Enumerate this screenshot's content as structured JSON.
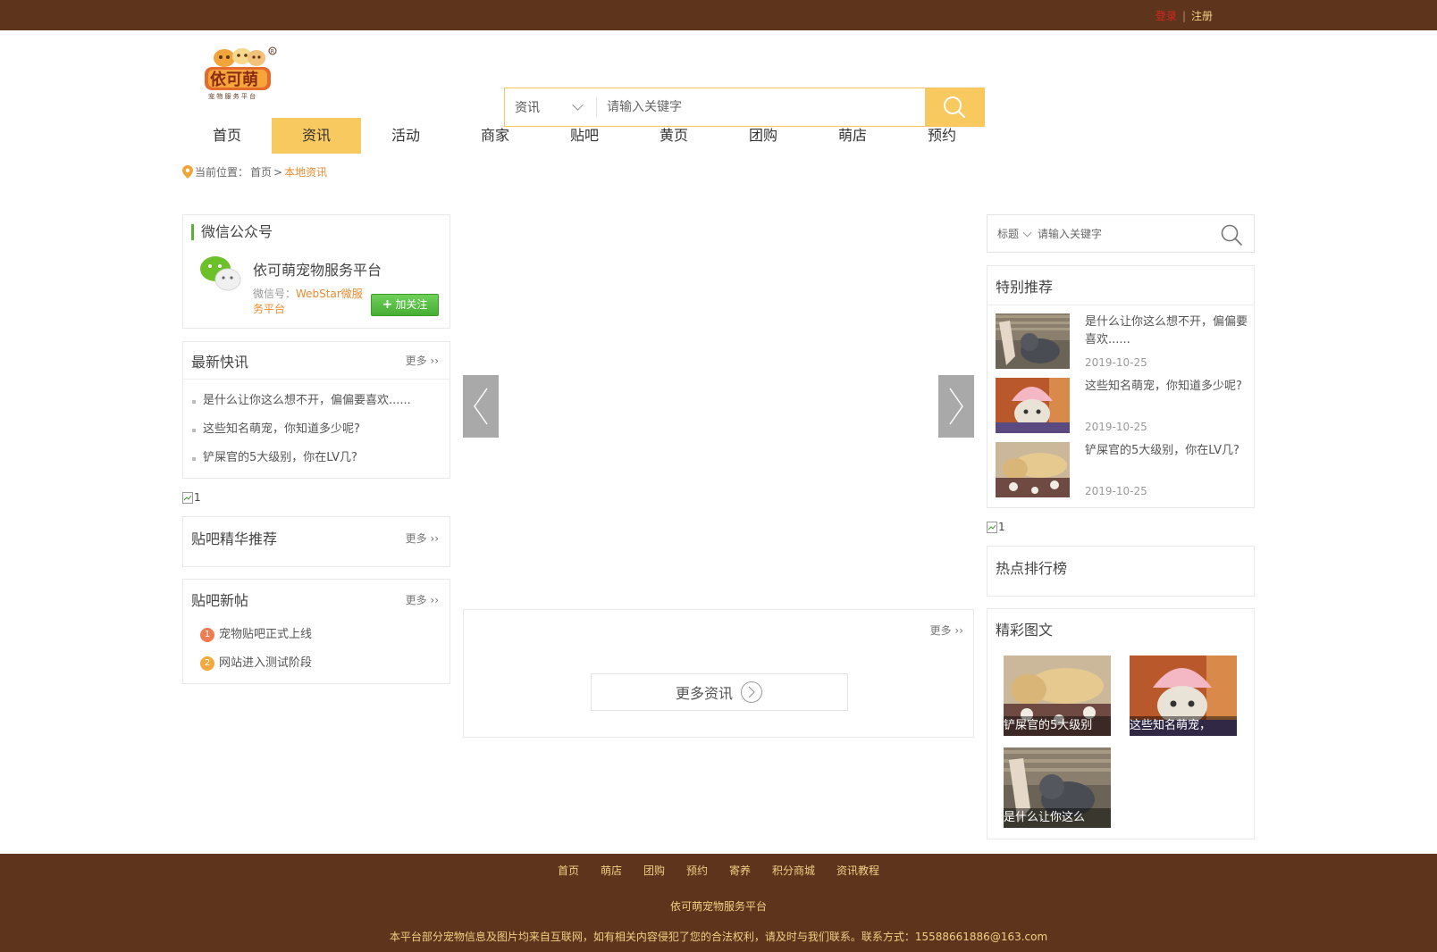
{
  "topbar": {
    "login": "登录",
    "separator": "|",
    "register": "注册"
  },
  "header": {
    "search_category": "资讯",
    "search_placeholder": "请输入关键字"
  },
  "nav": [
    {
      "label": "首页"
    },
    {
      "label": "资讯",
      "active": true
    },
    {
      "label": "活动"
    },
    {
      "label": "商家"
    },
    {
      "label": "贴吧"
    },
    {
      "label": "黄页"
    },
    {
      "label": "团购"
    },
    {
      "label": "萌店"
    },
    {
      "label": "预约"
    }
  ],
  "breadcrumb": {
    "prefix": "当前位置：",
    "home": "首页",
    "arrow": ">",
    "current": "本地资讯"
  },
  "wechat": {
    "title": "微信公众号",
    "name": "依可萌宠物服务平台",
    "id_label": "微信号：",
    "id_value": "WebStar微服务平台",
    "follow": "加关注"
  },
  "latest": {
    "title": "最新快讯",
    "more": "更多",
    "items": [
      "是什么让你这么想不开，偏偏要喜欢......",
      "这些知名萌宠，你知道多少呢?",
      "铲屎官的5大级别，你在LV几?"
    ]
  },
  "ad_left": "1",
  "tieba_best": {
    "title": "贴吧精华推荐",
    "more": "更多"
  },
  "tieba_new": {
    "title": "贴吧新帖",
    "more": "更多",
    "items": [
      {
        "num": "1",
        "text": "宠物贴吧正式上线"
      },
      {
        "num": "2",
        "text": "网站进入测试阶段"
      }
    ]
  },
  "center": {
    "more": "更多",
    "more_news": "更多资讯"
  },
  "right_search": {
    "type": "标题",
    "placeholder": "请输入关键字"
  },
  "featured": {
    "title": "特别推荐",
    "items": [
      {
        "title": "是什么让你这么想不开，偏偏要喜欢......",
        "date": "2019-10-25"
      },
      {
        "title": "这些知名萌宠，你知道多少呢?",
        "date": "2019-10-25"
      },
      {
        "title": "铲屎官的5大级别，你在LV几?",
        "date": "2019-10-25"
      }
    ]
  },
  "ad_right": "1",
  "hot": {
    "title": "热点排行榜"
  },
  "gallery": {
    "title": "精彩图文",
    "items": [
      {
        "caption": "铲屎官的5大级别"
      },
      {
        "caption": "这些知名萌宠，"
      },
      {
        "caption": "是什么让你这么"
      }
    ]
  },
  "footer": {
    "links": [
      "首页",
      "萌店",
      "团购",
      "预约",
      "寄养",
      "积分商城",
      "资讯教程"
    ],
    "name": "依可萌宠物服务平台",
    "note": "本平台部分宠物信息及图片均来自互联网，如有相关内容侵犯了您的合法权利，请及时与我们联系。联系方式：15588661886@163.com"
  },
  "colors": {
    "brown": "#5e341c",
    "gold": "#f8c95e",
    "orange": "#e98a2f",
    "green": "#5bb235"
  }
}
